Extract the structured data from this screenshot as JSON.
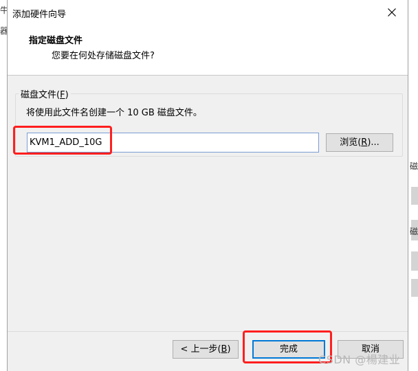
{
  "background_window": {
    "left_glyphs": [
      "牛",
      "器"
    ],
    "right_glyphs": [
      "磁",
      "磁"
    ]
  },
  "dialog": {
    "title": "添加硬件向导",
    "header": {
      "title": "指定磁盘文件",
      "subtitle": "您要在何处存储磁盘文件?"
    },
    "group": {
      "label_prefix": "磁盘文件(",
      "label_access_key": "F",
      "label_suffix": ")",
      "description": "将使用此文件名创建一个 10 GB 磁盘文件。",
      "filename_value": "KVM1_ADD_10G",
      "browse_prefix": "浏览(",
      "browse_access_key": "R",
      "browse_suffix": ")..."
    },
    "buttons": {
      "back_prefix": "< 上一步(",
      "back_access_key": "B",
      "back_suffix": ")",
      "finish": "完成",
      "cancel": "取消"
    }
  },
  "highlight_color": "#ff1e1e",
  "watermark": "CSDN @楊建业"
}
